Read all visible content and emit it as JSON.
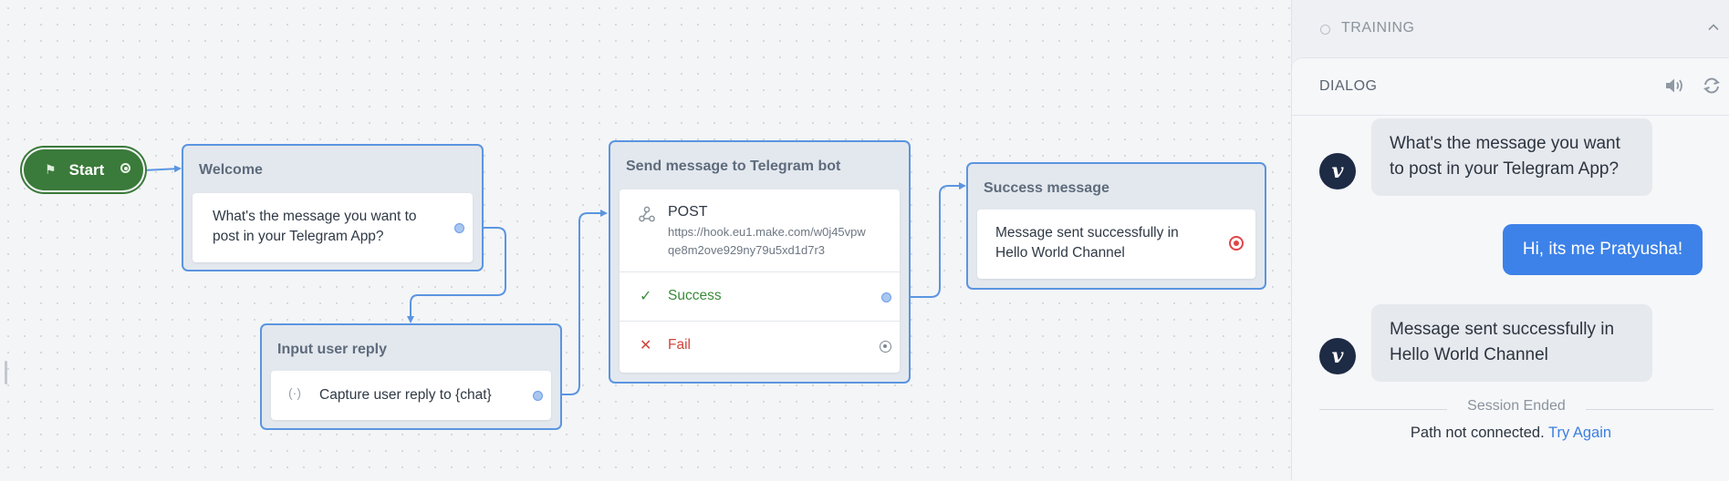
{
  "canvas": {
    "start": {
      "label": "Start",
      "icon": "flag-icon"
    },
    "welcome": {
      "title": "Welcome",
      "message": "What's the message you want to post in your Telegram App?"
    },
    "input_user_reply": {
      "title": "Input user reply",
      "capture_label": "Capture user reply to {chat}",
      "icon": "capture-icon"
    },
    "send_message": {
      "title": "Send message to Telegram bot",
      "method": "POST",
      "url_line1": "https://hook.eu1.make.com/w0j45vpw",
      "url_line2": "qe8m2ove929ny79u5xd1d7r3",
      "success_label": "Success",
      "fail_label": "Fail",
      "success_color": "#3b8a3b",
      "fail_color": "#d0453d",
      "icons": [
        "webhook-icon",
        "check-icon",
        "x-icon"
      ]
    },
    "success_message": {
      "title": "Success message",
      "message": "Message sent successfully in Hello World Channel"
    }
  },
  "panel": {
    "training_label": "TRAINING",
    "dialog_title": "DIALOG",
    "messages": [
      {
        "from": "bot",
        "text": "What's the message you want to post in your Telegram App?"
      },
      {
        "from": "user",
        "text": "Hi, its me Pratyusha!"
      },
      {
        "from": "bot",
        "text": "Message sent successfully in Hello World Channel"
      }
    ],
    "avatar_letter": "v",
    "session_ended": "Session Ended",
    "path_not_connected": "Path not connected.",
    "try_again": "Try Again"
  },
  "colors": {
    "accent": "#5b95e0",
    "start_green": "#3a7a3a",
    "user_bubble": "#3d82e8",
    "avatar_bg": "#1e2b45"
  }
}
